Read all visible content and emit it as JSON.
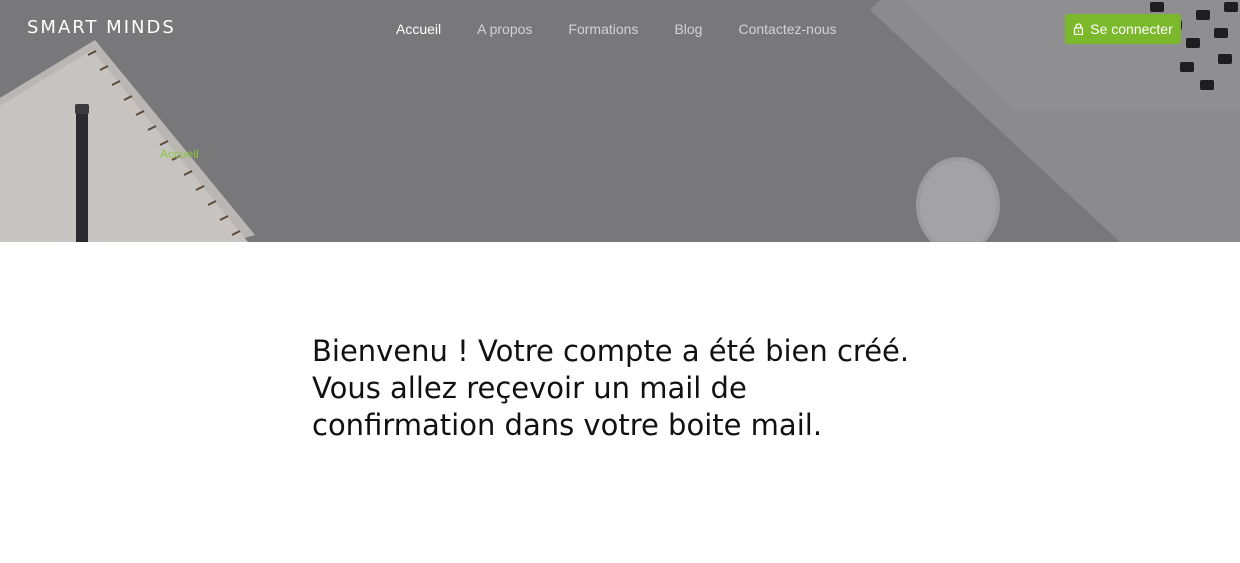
{
  "header": {
    "logo": "SMART MINDS",
    "nav": [
      {
        "label": "Accueil",
        "active": true
      },
      {
        "label": "A propos",
        "active": false
      },
      {
        "label": "Formations",
        "active": false
      },
      {
        "label": "Blog",
        "active": false
      },
      {
        "label": "Contactez-nous",
        "active": false
      }
    ],
    "login_label": "Se connecter",
    "login_icon": "lock-icon",
    "accent_color": "#7cb82b"
  },
  "hero": {
    "breadcrumb": "Accueil"
  },
  "main": {
    "message_line1": "Bienvenu ! Votre compte a été bien créé.",
    "message_line2": "Vous allez reçevoir un mail de",
    "message_line3": "confirmation dans votre boite mail."
  }
}
